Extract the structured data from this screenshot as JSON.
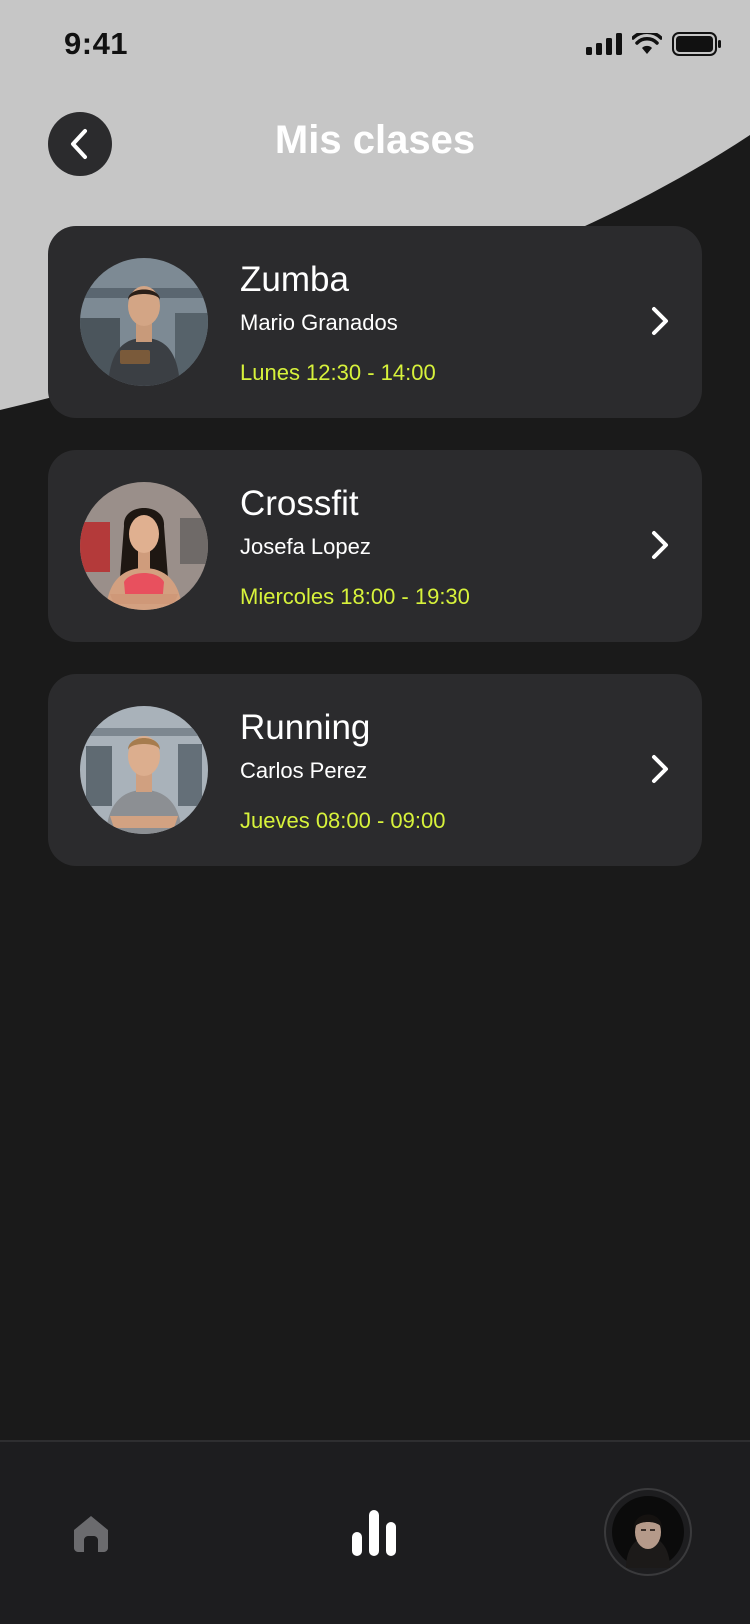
{
  "status_bar": {
    "time": "9:41"
  },
  "header": {
    "title": "Mis clases",
    "back_icon": "chevron-left-icon"
  },
  "colors": {
    "background": "#1a1a1a",
    "card": "#2b2b2d",
    "accent": "#d7f23b",
    "top_curve": "#c6c6c6"
  },
  "classes": [
    {
      "name": "Zumba",
      "trainer": "Mario Granados",
      "schedule": "Lunes 12:30 - 14:00"
    },
    {
      "name": "Crossfit",
      "trainer": "Josefa Lopez",
      "schedule": "Miercoles 18:00 - 19:30"
    },
    {
      "name": "Running",
      "trainer": "Carlos Perez",
      "schedule": "Jueves 08:00 - 09:00"
    }
  ],
  "bottom_nav": {
    "items": [
      {
        "icon": "home-icon",
        "active": false
      },
      {
        "icon": "bar-chart-icon",
        "active": true
      },
      {
        "icon": "profile-avatar",
        "active": false
      }
    ]
  }
}
